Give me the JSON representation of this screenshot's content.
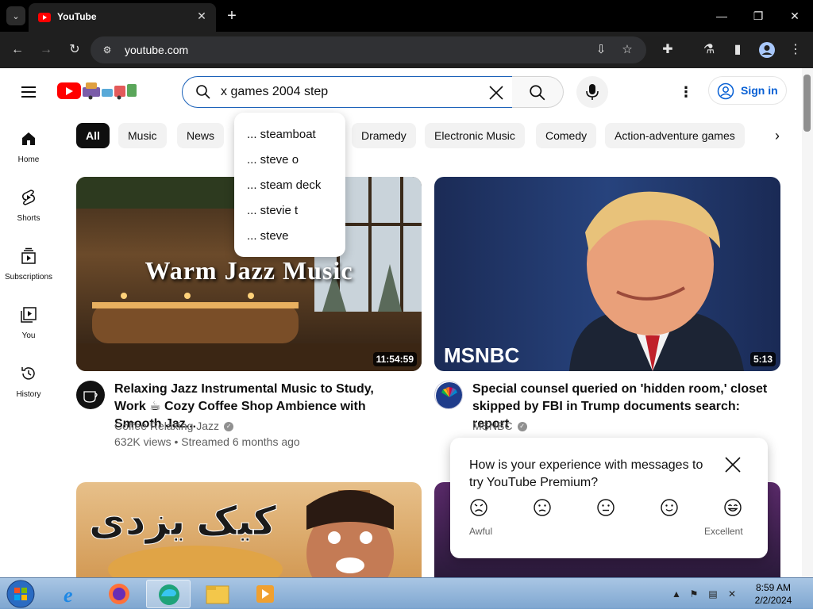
{
  "browser": {
    "tab_title": "YouTube",
    "url": "youtube.com",
    "tab_close": "✕",
    "new_tab": "+"
  },
  "search": {
    "query": "x games 2004 step",
    "suggestions": [
      "... steamboat",
      "... steve o",
      "... steam deck",
      "... stevie t",
      "... steve"
    ]
  },
  "masthead": {
    "signin_label": "Sign in"
  },
  "sidebar": {
    "items": [
      {
        "label": "Home",
        "icon": "home-icon"
      },
      {
        "label": "Shorts",
        "icon": "shorts-icon"
      },
      {
        "label": "Subscriptions",
        "icon": "subscriptions-icon"
      },
      {
        "label": "You",
        "icon": "you-icon"
      },
      {
        "label": "History",
        "icon": "history-icon"
      }
    ]
  },
  "chips": [
    "All",
    "Music",
    "News",
    "Dramedy",
    "Electronic Music",
    "Comedy",
    "Action-adventure games"
  ],
  "videos": [
    {
      "thumb_text": "Warm Jazz Music",
      "duration": "11:54:59",
      "title": "Relaxing Jazz Instrumental Music to Study, Work ☕ Cozy Coffee Shop Ambience with Smooth Jaz...",
      "channel": "Coffee Relaxing Jazz",
      "meta": "632K views • Streamed 6 months ago"
    },
    {
      "thumb_text": "MSNBC",
      "duration": "5:13",
      "title": "Special counsel queried on 'hidden room,' closet skipped by FBI in Trump documents search: report",
      "channel": "MSNBC",
      "meta": ""
    },
    {
      "thumb_text": "کیک یزدی",
      "duration": "",
      "title": "",
      "channel": "",
      "meta": ""
    }
  ],
  "survey": {
    "question": "How is your experience with messages to try YouTube Premium?",
    "low_label": "Awful",
    "high_label": "Excellent"
  },
  "taskbar": {
    "time": "8:59 AM",
    "date": "2/2/2024"
  },
  "colors": {
    "yt_red": "#ff0000",
    "link_blue": "#065fd4",
    "search_border": "#1c62b9"
  }
}
